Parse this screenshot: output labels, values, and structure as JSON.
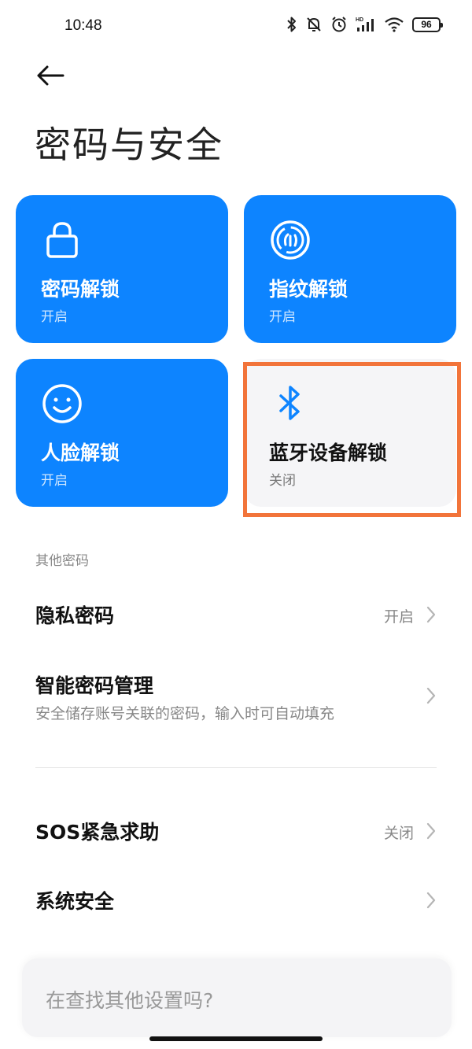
{
  "status_bar": {
    "time": "10:48",
    "battery": "96",
    "hd_label": "HD",
    "icons": [
      "bluetooth-icon",
      "mute-icon",
      "alarm-icon",
      "signal-icon",
      "wifi-icon",
      "battery-icon"
    ]
  },
  "header": {
    "title": "密码与安全"
  },
  "tiles": [
    {
      "title": "密码解锁",
      "status": "开启",
      "icon": "lock-icon",
      "enabled": true
    },
    {
      "title": "指纹解锁",
      "status": "开启",
      "icon": "fingerprint-icon",
      "enabled": true
    },
    {
      "title": "人脸解锁",
      "status": "开启",
      "icon": "face-icon",
      "enabled": true
    },
    {
      "title": "蓝牙设备解锁",
      "status": "关闭",
      "icon": "bluetooth-icon",
      "enabled": false
    }
  ],
  "other_passwords": {
    "section_label": "其他密码",
    "privacy": {
      "title": "隐私密码",
      "value": "开启"
    },
    "smart": {
      "title": "智能密码管理",
      "subtitle": "安全储存账号关联的密码，输入时可自动填充"
    }
  },
  "sos": {
    "title": "SOS紧急求助",
    "value": "关闭"
  },
  "system_security": {
    "title": "系统安全"
  },
  "search": {
    "placeholder": "在查找其他设置吗?"
  },
  "colors": {
    "accent": "#0d84ff",
    "highlight": "#f2743a",
    "tile_off": "#f5f5f7"
  }
}
